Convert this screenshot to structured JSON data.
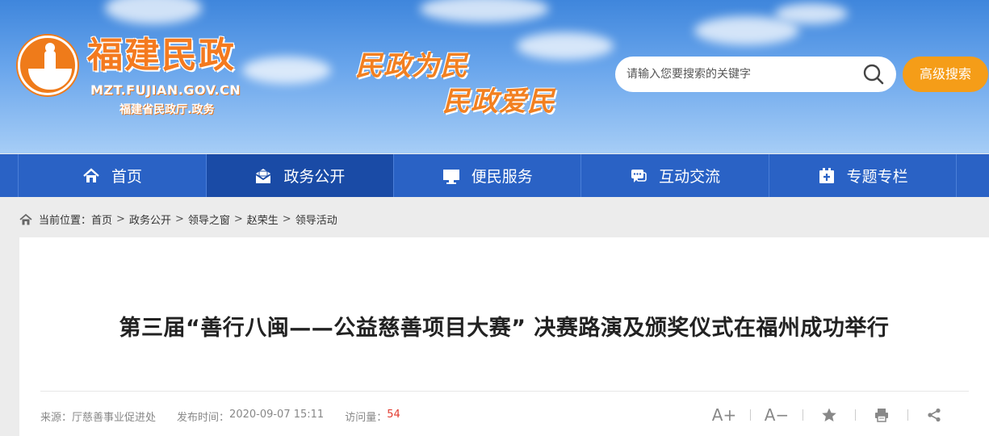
{
  "header": {
    "site_name": "福建民政",
    "domain": "MZT.FUJIAN.GOV.CN",
    "subtitle": "福建省民政厅.政务",
    "slogan_1": "民政为民",
    "slogan_2": "民政爱民",
    "search_placeholder": "请输入您要搜索的关键字",
    "advanced_search_label": "高级搜索"
  },
  "nav": {
    "items": [
      {
        "label": "首页",
        "icon": "home-icon"
      },
      {
        "label": "政务公开",
        "icon": "envelope-icon",
        "active": true
      },
      {
        "label": "便民服务",
        "icon": "monitor-icon"
      },
      {
        "label": "互动交流",
        "icon": "chat-icon"
      },
      {
        "label": "专题专栏",
        "icon": "topic-icon"
      }
    ]
  },
  "breadcrumb": {
    "prefix": "当前位置：",
    "items": [
      "首页",
      "政务公开",
      "领导之窗",
      "赵荣生",
      "领导活动"
    ],
    "separator": ">"
  },
  "article": {
    "title": "第三届“善行八闽——公益慈善项目大赛” 决赛路演及颁奖仪式在福州成功举行",
    "source_label": "来源：",
    "source": "厅慈善事业促进处",
    "date_label": "发布时间：",
    "date": "2020-09-07 15:11",
    "views_label": "访问量：",
    "views": "54"
  },
  "tools": {
    "font_larger": "A+",
    "font_smaller": "A−"
  },
  "colors": {
    "nav_bg": "#2a62c5",
    "nav_active": "#1a4ba6",
    "brand_orange": "#f47a1f",
    "advanced_btn": "#f59d18",
    "views_count": "#e23a2e"
  }
}
